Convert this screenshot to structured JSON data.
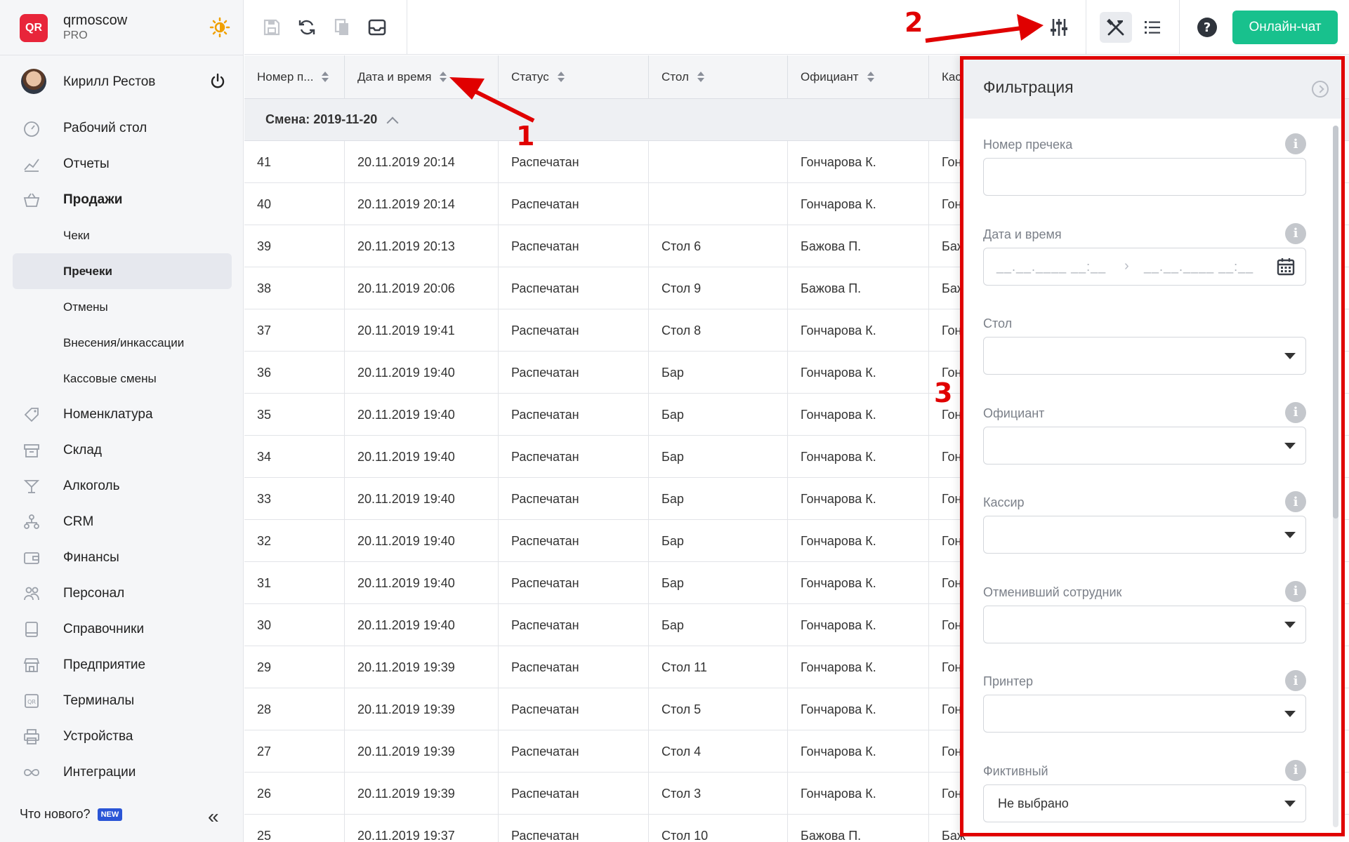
{
  "brand": {
    "name": "qrmoscow",
    "plan": "PRO",
    "logo": "QR"
  },
  "user": {
    "name": "Кирилл Рестов"
  },
  "nav": [
    {
      "label": "Рабочий стол",
      "icon": "dashboard-icon"
    },
    {
      "label": "Отчеты",
      "icon": "chart-icon"
    },
    {
      "label": "Продажи",
      "icon": "basket-icon"
    },
    {
      "label": "Чеки"
    },
    {
      "label": "Пречеки"
    },
    {
      "label": "Отмены"
    },
    {
      "label": "Внесения/инкассации"
    },
    {
      "label": "Кассовые смены"
    },
    {
      "label": "Номенклатура",
      "icon": "tag-icon"
    },
    {
      "label": "Склад",
      "icon": "box-icon"
    },
    {
      "label": "Алкоголь",
      "icon": "cocktail-icon"
    },
    {
      "label": "CRM",
      "icon": "crm-icon"
    },
    {
      "label": "Финансы",
      "icon": "wallet-icon"
    },
    {
      "label": "Персонал",
      "icon": "people-icon"
    },
    {
      "label": "Справочники",
      "icon": "book-icon"
    },
    {
      "label": "Предприятие",
      "icon": "store-icon"
    },
    {
      "label": "Терминалы",
      "icon": "qr-icon"
    },
    {
      "label": "Устройства",
      "icon": "printer-icon"
    },
    {
      "label": "Интеграции",
      "icon": "infinity-icon"
    }
  ],
  "footer": {
    "whats_new": "Что нового?",
    "badge": "NEW"
  },
  "toolbar": {
    "chat_label": "Онлайн-чат"
  },
  "table": {
    "columns": [
      "Номер п...",
      "Дата и время",
      "Статус",
      "Стол",
      "Официант",
      "Кас"
    ],
    "group_label": "Смена: 2019-11-20",
    "rows": [
      [
        "41",
        "20.11.2019 20:14",
        "Распечатан",
        "",
        "Гончарова К.",
        "Гон"
      ],
      [
        "40",
        "20.11.2019 20:14",
        "Распечатан",
        "",
        "Гончарова К.",
        "Гон"
      ],
      [
        "39",
        "20.11.2019 20:13",
        "Распечатан",
        "Стол 6",
        "Бажова П.",
        "Баж"
      ],
      [
        "38",
        "20.11.2019 20:06",
        "Распечатан",
        "Стол 9",
        "Бажова П.",
        "Баж"
      ],
      [
        "37",
        "20.11.2019 19:41",
        "Распечатан",
        "Стол 8",
        "Гончарова К.",
        "Гон"
      ],
      [
        "36",
        "20.11.2019 19:40",
        "Распечатан",
        "Бар",
        "Гончарова К.",
        "Гон"
      ],
      [
        "35",
        "20.11.2019 19:40",
        "Распечатан",
        "Бар",
        "Гончарова К.",
        "Гон"
      ],
      [
        "34",
        "20.11.2019 19:40",
        "Распечатан",
        "Бар",
        "Гончарова К.",
        "Гон"
      ],
      [
        "33",
        "20.11.2019 19:40",
        "Распечатан",
        "Бар",
        "Гончарова К.",
        "Гон"
      ],
      [
        "32",
        "20.11.2019 19:40",
        "Распечатан",
        "Бар",
        "Гончарова К.",
        "Гон"
      ],
      [
        "31",
        "20.11.2019 19:40",
        "Распечатан",
        "Бар",
        "Гончарова К.",
        "Гон"
      ],
      [
        "30",
        "20.11.2019 19:40",
        "Распечатан",
        "Бар",
        "Гончарова К.",
        "Гон"
      ],
      [
        "29",
        "20.11.2019 19:39",
        "Распечатан",
        "Стол 11",
        "Гончарова К.",
        "Гон"
      ],
      [
        "28",
        "20.11.2019 19:39",
        "Распечатан",
        "Стол 5",
        "Гончарова К.",
        "Гон"
      ],
      [
        "27",
        "20.11.2019 19:39",
        "Распечатан",
        "Стол 4",
        "Гончарова К.",
        "Гон"
      ],
      [
        "26",
        "20.11.2019 19:39",
        "Распечатан",
        "Стол 3",
        "Гончарова К.",
        "Гон"
      ],
      [
        "25",
        "20.11.2019 19:37",
        "Распечатан",
        "Стол 10",
        "Бажова П.",
        "Баж"
      ]
    ]
  },
  "filter": {
    "title": "Фильтрация",
    "fields": [
      {
        "label": "Номер пречека",
        "type": "text",
        "info": true,
        "value": ""
      },
      {
        "label": "Дата и время",
        "type": "daterange",
        "info": true,
        "mask": "__.__.____ __:__"
      },
      {
        "label": "Стол",
        "type": "select",
        "info": false,
        "value": ""
      },
      {
        "label": "Официант",
        "type": "select",
        "info": true,
        "value": ""
      },
      {
        "label": "Кассир",
        "type": "select",
        "info": true,
        "value": ""
      },
      {
        "label": "Отменивший сотрудник",
        "type": "select",
        "info": true,
        "value": ""
      },
      {
        "label": "Принтер",
        "type": "select",
        "info": true,
        "value": ""
      },
      {
        "label": "Фиктивный",
        "type": "select",
        "info": true,
        "value": "Не выбрано"
      }
    ]
  },
  "annotations": [
    "1",
    "2",
    "3"
  ],
  "colors": {
    "accent_green": "#18c18d",
    "annotation_red": "#e00000",
    "brand_red": "#e8253a",
    "badge_blue": "#2a55d6"
  }
}
